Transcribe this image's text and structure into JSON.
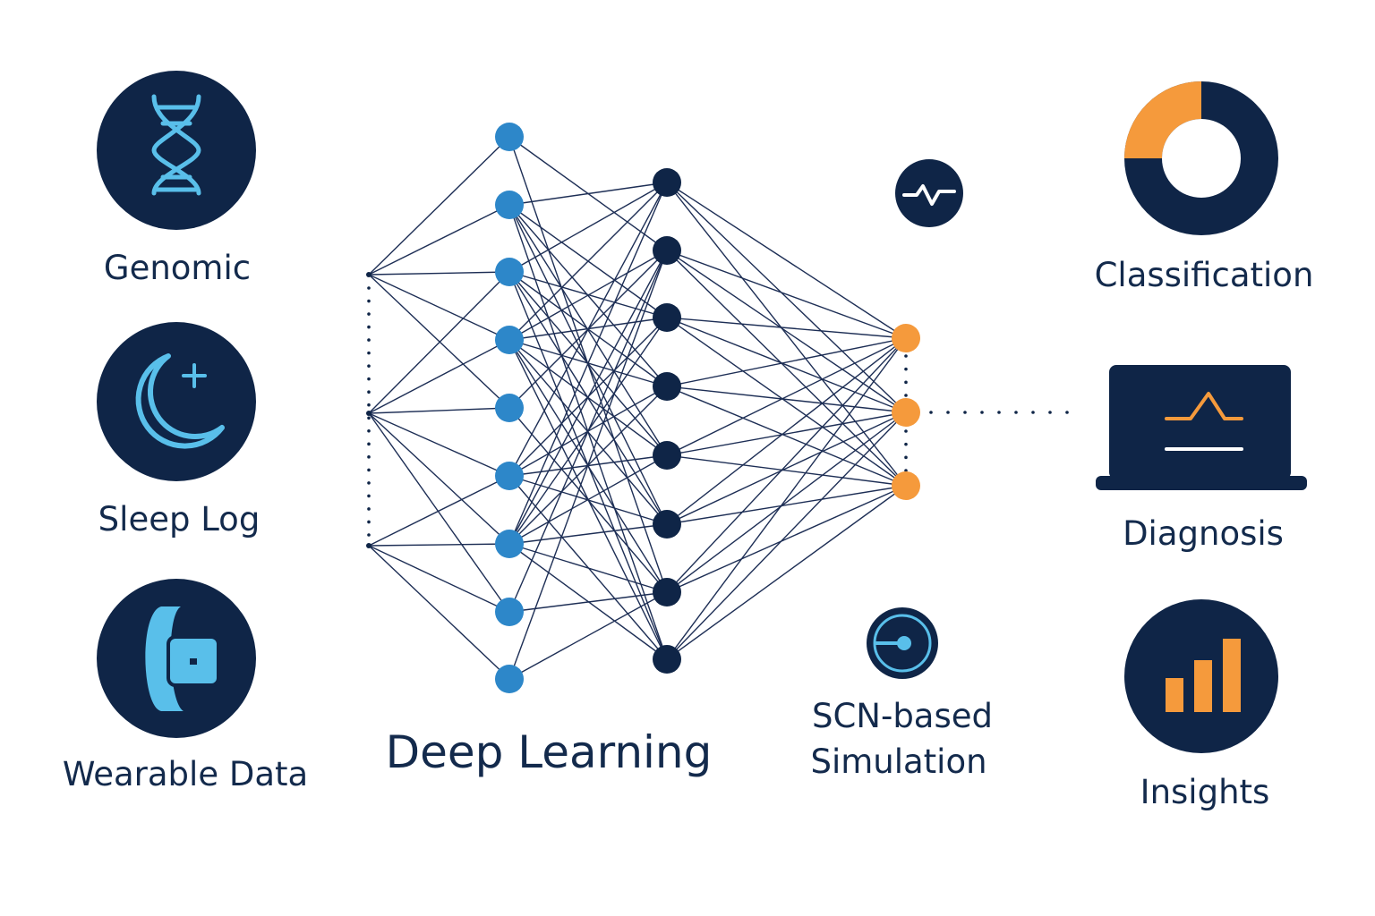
{
  "inputs": {
    "genomic": {
      "label": "Genomic",
      "icon": "dna-icon"
    },
    "sleep_log": {
      "label": "Sleep Log",
      "icon": "moon-icon"
    },
    "wearable": {
      "label": "Wearable Data",
      "icon": "smartwatch-icon"
    }
  },
  "network": {
    "label": "Deep Learning",
    "input_nodes": 3,
    "layer1_nodes": 9,
    "layer2_nodes": 8,
    "output_nodes": 3
  },
  "simulation": {
    "label_line1": "SCN-based",
    "label_line2": "Simulation",
    "icons": [
      "heartbeat-icon",
      "dial-icon"
    ]
  },
  "outputs": {
    "classification": {
      "label": "Classification",
      "icon": "donut-chart-icon"
    },
    "diagnosis": {
      "label": "Diagnosis",
      "icon": "laptop-icon"
    },
    "insights": {
      "label": "Insights",
      "icon": "bar-chart-icon"
    }
  },
  "colors": {
    "navy": "#0f2547",
    "label": "#132a4c",
    "blue": "#2d87c9",
    "light_blue": "#59bfea",
    "orange": "#f59a3c",
    "line": "#1d2e55"
  }
}
